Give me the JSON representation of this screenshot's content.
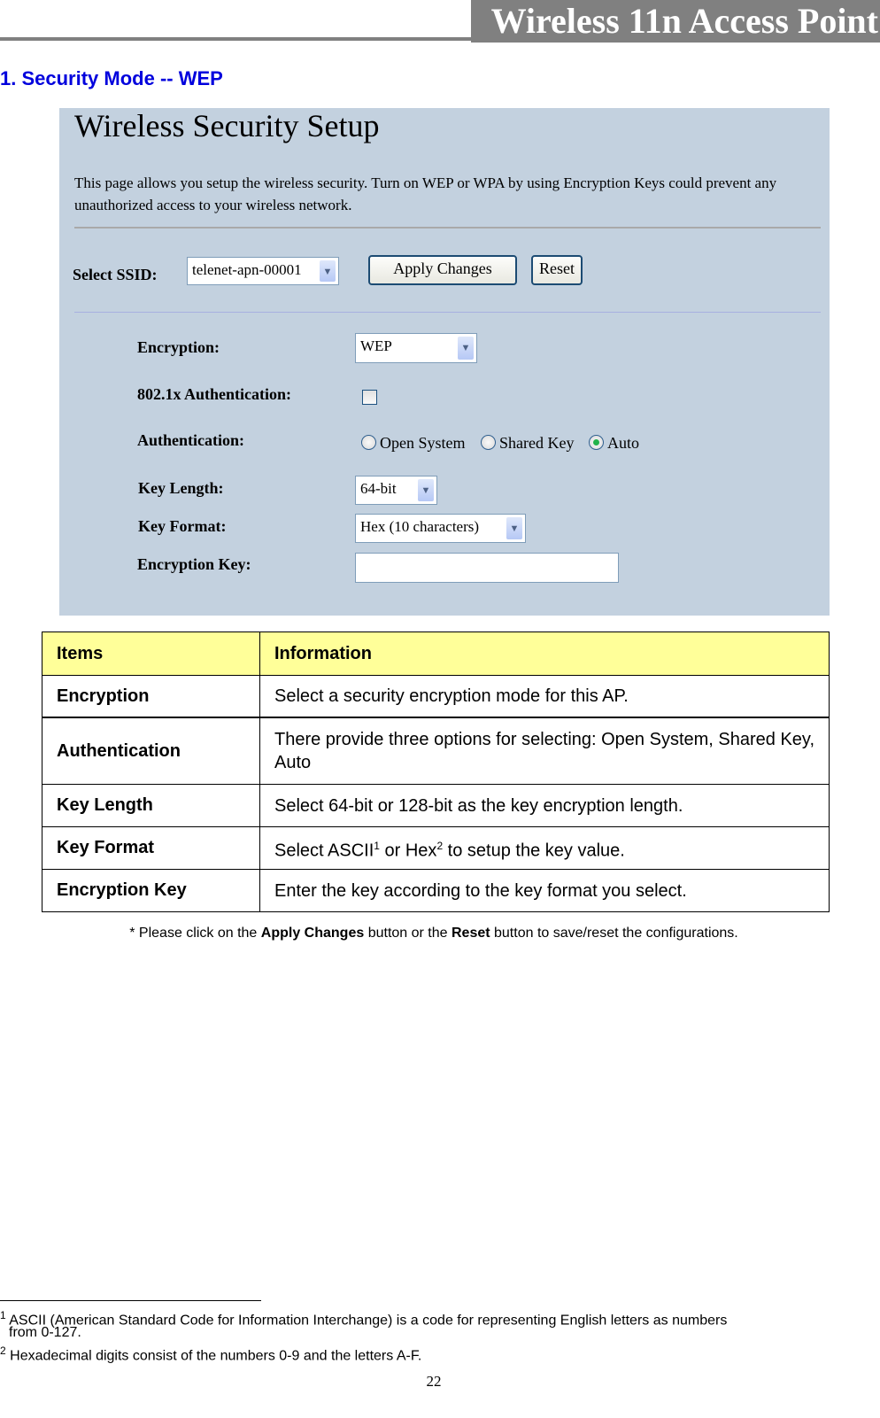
{
  "header": {
    "title": "Wireless 11n Access Point"
  },
  "section_title": "1. Security Mode -- WEP",
  "screenshot": {
    "title": "Wireless Security Setup",
    "description": "This page allows you setup the wireless security. Turn on WEP or WPA by using Encryption Keys could prevent any unauthorized access to your wireless network.",
    "ssid_label": "Select SSID:",
    "ssid_value": "telenet-apn-00001",
    "apply_label": "Apply Changes",
    "reset_label": "Reset",
    "encryption_label": "Encryption:",
    "encryption_value": "WEP",
    "dot1x_label": "802.1x Authentication:",
    "dot1x_checked": false,
    "authentication_label": "Authentication:",
    "auth_options": [
      {
        "label": "Open System",
        "selected": false
      },
      {
        "label": "Shared Key",
        "selected": false
      },
      {
        "label": "Auto",
        "selected": true
      }
    ],
    "key_length_label": "Key Length:",
    "key_length_value": "64-bit",
    "key_format_label": "Key Format:",
    "key_format_value": "Hex (10 characters)",
    "encryption_key_label": "Encryption Key:",
    "encryption_key_value": ""
  },
  "table": {
    "headers": [
      "Items",
      "Information"
    ],
    "rows": [
      {
        "item": "Encryption",
        "info": "Select a security encryption mode for this AP."
      },
      {
        "item": "Authentication",
        "info": "There provide three options for selecting: Open System, Shared Key, Auto"
      },
      {
        "item": "Key Length",
        "info": "Select 64-bit or 128-bit as the key encryption length."
      },
      {
        "item": "Key Format",
        "info_parts": [
          "Select ASCII",
          "1",
          " or Hex",
          "2",
          " to setup the key value."
        ]
      },
      {
        "item": "Encryption Key",
        "info": "Enter the key according to the key format you select."
      }
    ]
  },
  "note": {
    "prefix": "* Please click on the ",
    "apply": "Apply Changes",
    "middle": " button or the ",
    "reset": "Reset",
    "suffix": " button to save/reset the configurations."
  },
  "footnotes": [
    {
      "mark": "1",
      "text": "ASCII (American Standard Code for Information Interchange) is a code for representing English letters as numbers",
      "text2": "from 0-127."
    },
    {
      "mark": "2",
      "text": "Hexadecimal digits consist of the numbers 0-9 and the letters A-F."
    }
  ],
  "page_number": "22"
}
